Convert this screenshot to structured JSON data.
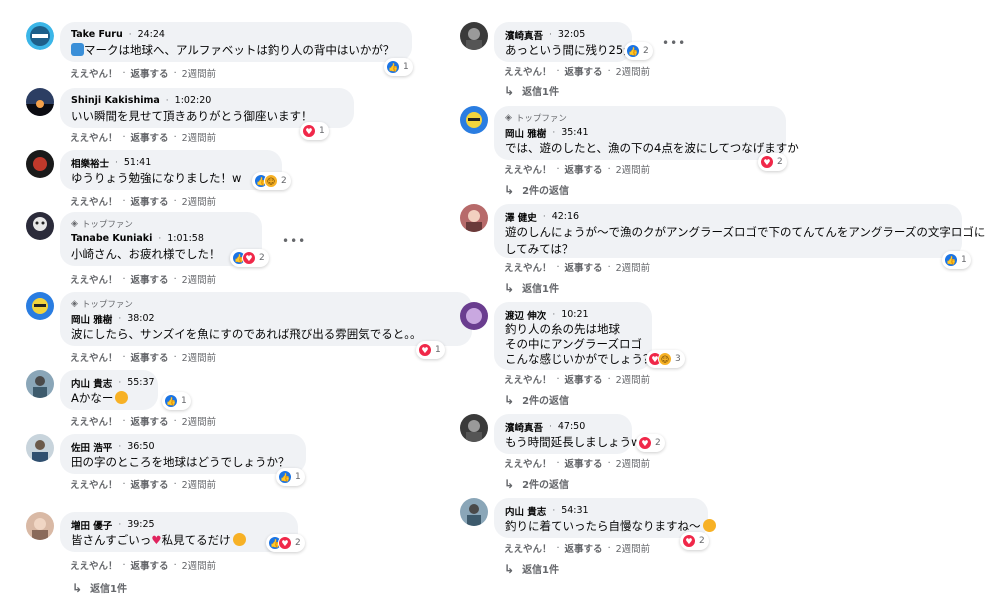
{
  "actions": {
    "like": "ええやん！",
    "reply": "返事する",
    "ago": "2週間前"
  },
  "top_fan": "トップファン",
  "comments_left": [
    {
      "name": "Take Furu",
      "time": "24:24",
      "text": [
        "マークは地球へ、アルファベットは釣り人の背中はいかが？"
      ],
      "reactions": [
        "like"
      ],
      "count": "1"
    },
    {
      "name": "Shinji Kakishima",
      "time": "1:02:20",
      "text": [
        "いい瞬間を見せて頂きありがとう御座います！"
      ],
      "reactions": [
        "love"
      ],
      "count": "1"
    },
    {
      "name": "相樂裕士",
      "time": "51:41",
      "text": [
        "ゆうりょう勉強になりました！w"
      ],
      "reactions": [
        "like",
        "haha"
      ],
      "count": "2"
    },
    {
      "name": "Tanabe Kuniaki",
      "time": "1:01:58",
      "text": [
        "小崎さん、お疲れ様でした！"
      ],
      "reactions": [
        "like",
        "love"
      ],
      "count": "2"
    },
    {
      "name": "岡山 雅樹",
      "time": "38:02",
      "text": [
        "波にしたら、サンズイを魚にすのであれば飛び出る雰囲気でると。。"
      ],
      "reactions": [
        "love"
      ],
      "count": "1"
    },
    {
      "name": "内山 貴志",
      "time": "55:37",
      "text": [
        "Aかなー"
      ],
      "reactions": [
        "like"
      ],
      "count": "1"
    },
    {
      "name": "佐田 浩平",
      "time": "36:50",
      "text": [
        "田の字のところを地球はどうでしょうか？"
      ],
      "reactions": [
        "like"
      ],
      "count": "1"
    },
    {
      "name": "増田 優子",
      "time": "39:25",
      "text": [
        "皆さんすごいっ",
        "私見てるだけ"
      ],
      "reactions": [
        "like",
        "love"
      ],
      "count": "2",
      "replies": "返信1件"
    }
  ],
  "comments_right": [
    {
      "name": "濱崎真吾",
      "time": "32:05",
      "text": [
        "あっという間に残り25分"
      ],
      "reactions": [
        "like"
      ],
      "count": "2",
      "replies": "返信1件"
    },
    {
      "name": "岡山 雅樹",
      "time": "35:41",
      "text": [
        "では、遊のしたと、漁の下の4点を波にしてつなげますか"
      ],
      "reactions": [
        "love"
      ],
      "count": "2",
      "replies": "2件の返信"
    },
    {
      "name": "澤 健史",
      "time": "42:16",
      "text": [
        "遊のしんにょうが〜で漁のクがアングラーズロゴで下のてんてんをアングラーズの文字ロゴに",
        "してみては？"
      ],
      "reactions": [
        "like"
      ],
      "count": "1",
      "replies": "返信1件"
    },
    {
      "name": "渡辺 伸次",
      "time": "10:21",
      "text": [
        "釣り人の糸の先は地球",
        "その中にアングラーズロゴ",
        "こんな感じいかがでしょう？"
      ],
      "reactions": [
        "love",
        "haha"
      ],
      "count": "3",
      "replies": "2件の返信"
    },
    {
      "name": "濱崎真吾",
      "time": "47:50",
      "text": [
        "もう時間延長しましょうww"
      ],
      "reactions": [
        "love"
      ],
      "count": "2",
      "replies": "2件の返信"
    },
    {
      "name": "内山 貴志",
      "time": "54:31",
      "text": [
        "釣りに着ていったら自慢なりますね〜"
      ],
      "reactions": [
        "love"
      ],
      "count": "2",
      "replies": "返信1件"
    }
  ],
  "colors": {
    "bubble": "#f0f2f5",
    "meta": "#65676b",
    "like": "#1b74e4",
    "love": "#f02849"
  },
  "icons": {
    "like": "thumbs-up-icon",
    "love": "heart-icon",
    "haha": "laugh-icon",
    "replies_arrow": "reply-arrow-icon",
    "top_fan": "diamond-icon",
    "more": "more-options-icon"
  }
}
